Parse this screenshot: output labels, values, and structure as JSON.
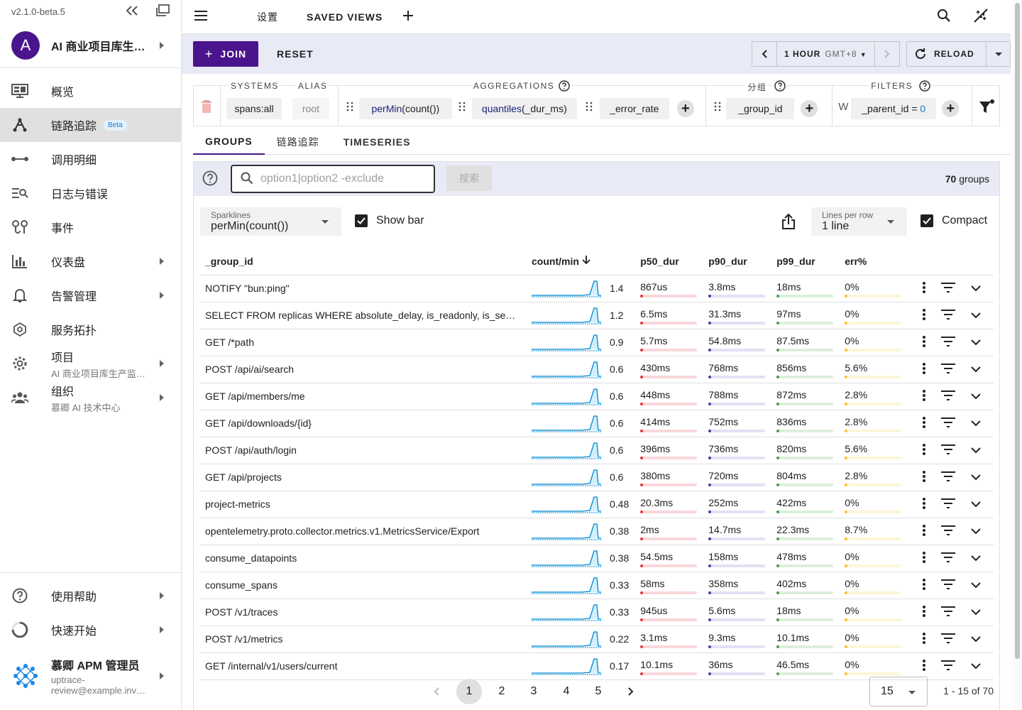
{
  "version": "v2.1.0-beta.5",
  "project": {
    "avatar_letter": "A",
    "name": "AI 商业项目库生…"
  },
  "nav": [
    {
      "label": "概览",
      "icon": "monitor-dashboard-icon",
      "active": false
    },
    {
      "label": "链路追踪",
      "icon": "graph-icon",
      "badge": "Beta",
      "active": true
    },
    {
      "label": "调用明细",
      "icon": "span-line-icon"
    },
    {
      "label": "日志与错误",
      "icon": "text-search-icon"
    },
    {
      "label": "事件",
      "icon": "map-marker-path-icon"
    },
    {
      "label": "仪表盘",
      "icon": "bar-chart-icon",
      "expandable": true
    },
    {
      "label": "告警管理",
      "icon": "bell-icon",
      "expandable": true
    },
    {
      "label": "服务拓扑",
      "icon": "hub-icon"
    },
    {
      "label": "项目",
      "sub": "AI 商业项目库生产监…",
      "icon": "gear-icon",
      "expandable": true
    },
    {
      "label": "组织",
      "sub": "慕卿 AI 技术中心",
      "icon": "group-icon",
      "expandable": true
    }
  ],
  "bottom_nav": {
    "help": "使用帮助",
    "quickstart": "快速开始",
    "user_name": "慕卿 APM 管理员",
    "user_email_1": "uptrace-",
    "user_email_2": "review@example.inv…"
  },
  "topbar": {
    "settings": "设置",
    "saved_views": "SAVED VIEWS"
  },
  "toolbar": {
    "join": "JOIN",
    "reset": "RESET",
    "period": "1 HOUR",
    "timezone": "GMT+8",
    "reload": "RELOAD"
  },
  "query": {
    "systems_label": "SYSTEMS",
    "systems_value": "spans:all",
    "alias_label": "ALIAS",
    "alias_value": "root",
    "aggregations_label": "AGGREGATIONS",
    "agg1_fn": "perMin",
    "agg1_arg": "(count())",
    "agg2_fn": "quantiles",
    "agg2_arg": "(_dur_ms)",
    "agg3": "_error_rate",
    "group_label": "分组",
    "group_value": "_group_id",
    "filters_label": "FILTERS",
    "filter_prefix": "W",
    "filter_key": "_parent_id",
    "filter_op": "=",
    "filter_val": "0"
  },
  "tabs": [
    "GROUPS",
    "链路追踪",
    "TIMESERIES"
  ],
  "search": {
    "placeholder": "option1|option2 -exclude",
    "button": "搜索",
    "count": "70",
    "count_suffix": "groups"
  },
  "controls": {
    "sparklines_label": "Sparklines",
    "sparklines_value": "perMin(count())",
    "show_bar": "Show bar",
    "lines_label": "Lines per row",
    "lines_value": "1 line",
    "compact": "Compact"
  },
  "columns": [
    "_group_id",
    "count/min",
    "p50_dur",
    "p90_dur",
    "p99_dur",
    "err%"
  ],
  "colors": {
    "p50": "#f8d7da",
    "p50_fill": "#e53935",
    "p90": "#e3e0f5",
    "p90_fill": "#5e35b1",
    "p99": "#dcefdc",
    "p99_fill": "#43a047",
    "err": "#fdf6d8",
    "err_fill": "#fbc02d",
    "accent": "#4a148c"
  },
  "rows": [
    {
      "name": "NOTIFY \"bun:ping\"",
      "rate": "1.4",
      "p50": "867us",
      "p90": "3.8ms",
      "p99": "18ms",
      "err": "0%"
    },
    {
      "name": "SELECT FROM replicas WHERE absolute_delay, is_readonly, is_session_expired",
      "rate": "1.2",
      "p50": "6.5ms",
      "p90": "31.3ms",
      "p99": "97ms",
      "err": "0%"
    },
    {
      "name": "GET /*path",
      "rate": "0.9",
      "p50": "5.7ms",
      "p90": "54.8ms",
      "p99": "87.5ms",
      "err": "0%"
    },
    {
      "name": "POST /api/ai/search",
      "rate": "0.6",
      "p50": "430ms",
      "p90": "768ms",
      "p99": "856ms",
      "err": "5.6%"
    },
    {
      "name": "GET /api/members/me",
      "rate": "0.6",
      "p50": "448ms",
      "p90": "788ms",
      "p99": "872ms",
      "err": "2.8%"
    },
    {
      "name": "GET /api/downloads/{id}",
      "rate": "0.6",
      "p50": "414ms",
      "p90": "752ms",
      "p99": "836ms",
      "err": "2.8%"
    },
    {
      "name": "POST /api/auth/login",
      "rate": "0.6",
      "p50": "396ms",
      "p90": "736ms",
      "p99": "820ms",
      "err": "5.6%"
    },
    {
      "name": "GET /api/projects",
      "rate": "0.6",
      "p50": "380ms",
      "p90": "720ms",
      "p99": "804ms",
      "err": "2.8%"
    },
    {
      "name": "project-metrics",
      "rate": "0.48",
      "p50": "20.3ms",
      "p90": "252ms",
      "p99": "422ms",
      "err": "0%"
    },
    {
      "name": "opentelemetry.proto.collector.metrics.v1.MetricsService/Export",
      "rate": "0.38",
      "p50": "2ms",
      "p90": "14.7ms",
      "p99": "22.3ms",
      "err": "8.7%"
    },
    {
      "name": "consume_datapoints",
      "rate": "0.38",
      "p50": "54.5ms",
      "p90": "158ms",
      "p99": "478ms",
      "err": "0%"
    },
    {
      "name": "consume_spans",
      "rate": "0.33",
      "p50": "58ms",
      "p90": "358ms",
      "p99": "402ms",
      "err": "0%"
    },
    {
      "name": "POST /v1/traces",
      "rate": "0.33",
      "p50": "945us",
      "p90": "5.6ms",
      "p99": "18ms",
      "err": "0%"
    },
    {
      "name": "POST /v1/metrics",
      "rate": "0.22",
      "p50": "3.1ms",
      "p90": "9.3ms",
      "p99": "10.1ms",
      "err": "0%"
    },
    {
      "name": "GET /internal/v1/users/current",
      "rate": "0.17",
      "p50": "10.1ms",
      "p90": "36ms",
      "p99": "46.5ms",
      "err": "0%"
    }
  ],
  "pagination": {
    "pages": [
      "1",
      "2",
      "3",
      "4",
      "5"
    ],
    "current": "1",
    "per_page": "15",
    "range": "1 - 15 of 70"
  }
}
